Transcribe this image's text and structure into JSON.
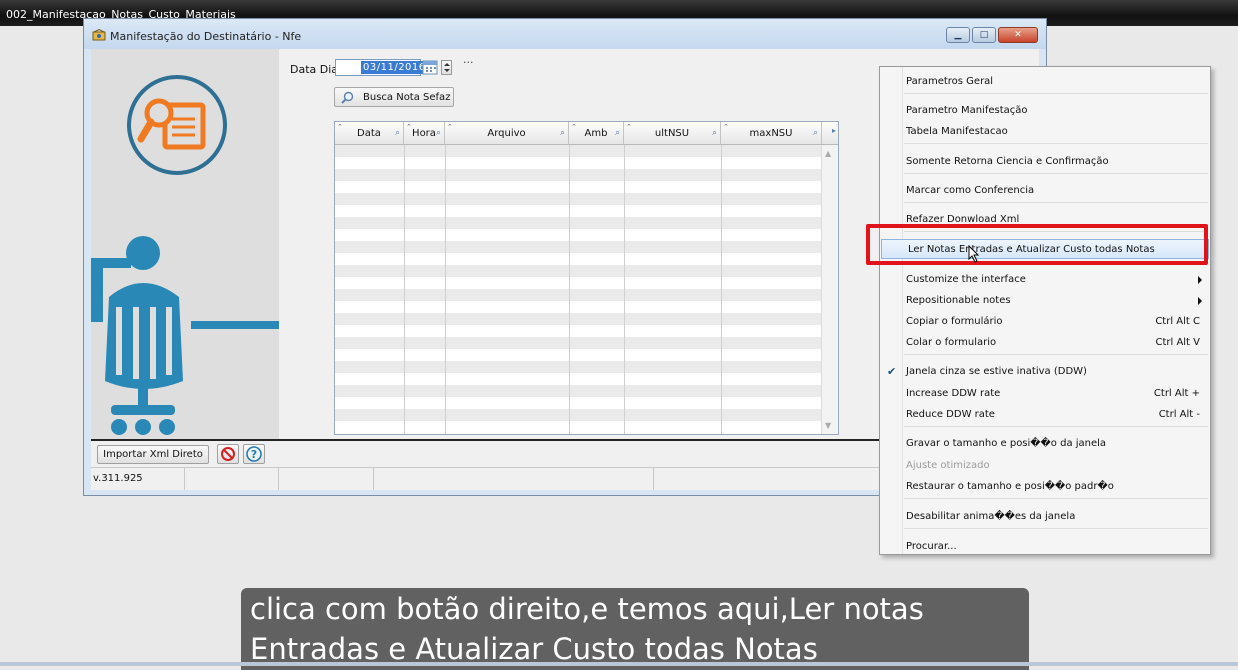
{
  "video": {
    "title": "002_Manifestacao_Notas_Custo_Materiais"
  },
  "window": {
    "title": "Manifestação do Destinatário - Nfe",
    "controls": [
      "minimize",
      "maximize",
      "close"
    ]
  },
  "filter": {
    "date_label": "Data Dia",
    "date_value": "03/11/2016",
    "more": "...",
    "search_button": "Busca Nota Sefaz"
  },
  "grid": {
    "columns": [
      "Data",
      "Hora",
      "Arquivo",
      "Amb",
      "ultNSU",
      "maxNSU"
    ],
    "rows": []
  },
  "bottom": {
    "import_button": "Importar Xml Direto",
    "version": "v.311.925"
  },
  "context_menu": {
    "items": [
      {
        "label": "Parametros Geral"
      },
      {
        "label": "Parametro Manifestação"
      },
      {
        "label": "Tabela Manifestacao"
      },
      {
        "label": "Somente Retorna Ciencia e Confirmação"
      },
      {
        "label": "Marcar como Conferencia"
      },
      {
        "label": "Refazer Donwload Xml"
      },
      {
        "label": "Ler Notas Entradas e Atualizar Custo todas Notas",
        "highlighted": true
      },
      {
        "label": "Customize the interface",
        "submenu": true
      },
      {
        "label": "Repositionable notes",
        "submenu": true
      },
      {
        "label": "Copiar o formulário",
        "shortcut": "Ctrl Alt C"
      },
      {
        "label": "Colar o formulario",
        "shortcut": "Ctrl Alt V"
      },
      {
        "label": "Janela cinza se estive inativa (DDW)",
        "checked": true
      },
      {
        "label": "Increase DDW rate",
        "shortcut": "Ctrl Alt +"
      },
      {
        "label": "Reduce DDW rate",
        "shortcut": "Ctrl Alt -"
      },
      {
        "label": "Gravar o tamanho e posi��o da janela"
      },
      {
        "label": "Ajuste otimizado",
        "disabled": true
      },
      {
        "label": "Restaurar o tamanho e posi��o padr�o"
      },
      {
        "label": "Desabilitar anima��es da janela"
      },
      {
        "label": "Procurar..."
      }
    ]
  },
  "subtitle": {
    "line1": "clica com botão direito,e temos aqui,Ler notas",
    "line2": "Entradas e Atualizar Custo todas Notas"
  }
}
